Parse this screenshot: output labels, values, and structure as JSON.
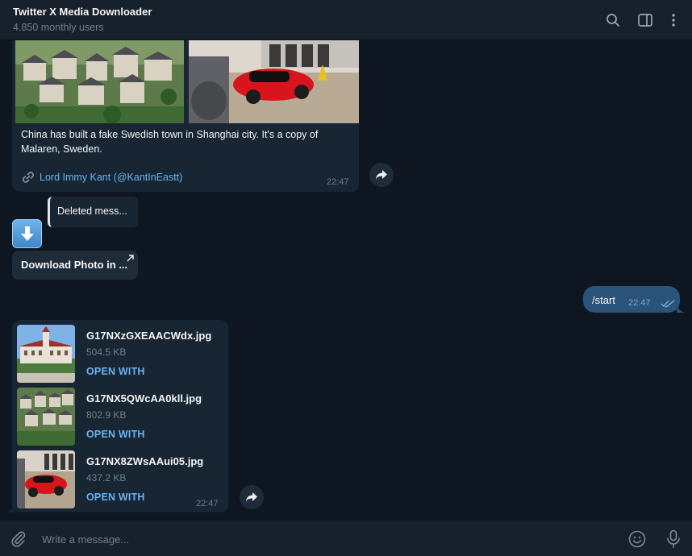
{
  "header": {
    "title": "Twitter X Media Downloader",
    "subtitle": "4.850 monthly users",
    "icons": [
      "search-icon",
      "sidebar-toggle-icon",
      "more-vertical-icon"
    ]
  },
  "messages": {
    "album": {
      "caption": "China has built a fake Swedish town in Shanghai city. It's a copy of Malaren, Sweden.",
      "link_icon": "link-icon",
      "link_text": "Lord Immy Kant (@KantInEastt)",
      "time": "22:47"
    },
    "deleted": {
      "text": "Deleted mess..."
    },
    "download_button": {
      "label": "Download Photo in ..."
    },
    "outgoing": {
      "text": "/start",
      "time": "22:47"
    },
    "files": {
      "items": [
        {
          "name": "G17NXzGXEAACWdx.jpg",
          "size": "504.5 KB",
          "action": "OPEN WITH"
        },
        {
          "name": "G17NX5QWcAA0kll.jpg",
          "size": "802.9 KB",
          "action": "OPEN WITH"
        },
        {
          "name": "G17NX8ZWsAAui05.jpg",
          "size": "437.2 KB",
          "action": "OPEN WITH"
        }
      ],
      "time": "22:47"
    }
  },
  "composer": {
    "placeholder": "Write a message...",
    "icons": [
      "paperclip-icon",
      "emoji-icon",
      "microphone-icon"
    ]
  },
  "colors": {
    "background": "#0e1621",
    "header": "#17212b",
    "incoming_bubble": "#182533",
    "outgoing_bubble": "#2b5278",
    "accent": "#6ab3f3",
    "muted": "#6d7f8f"
  }
}
